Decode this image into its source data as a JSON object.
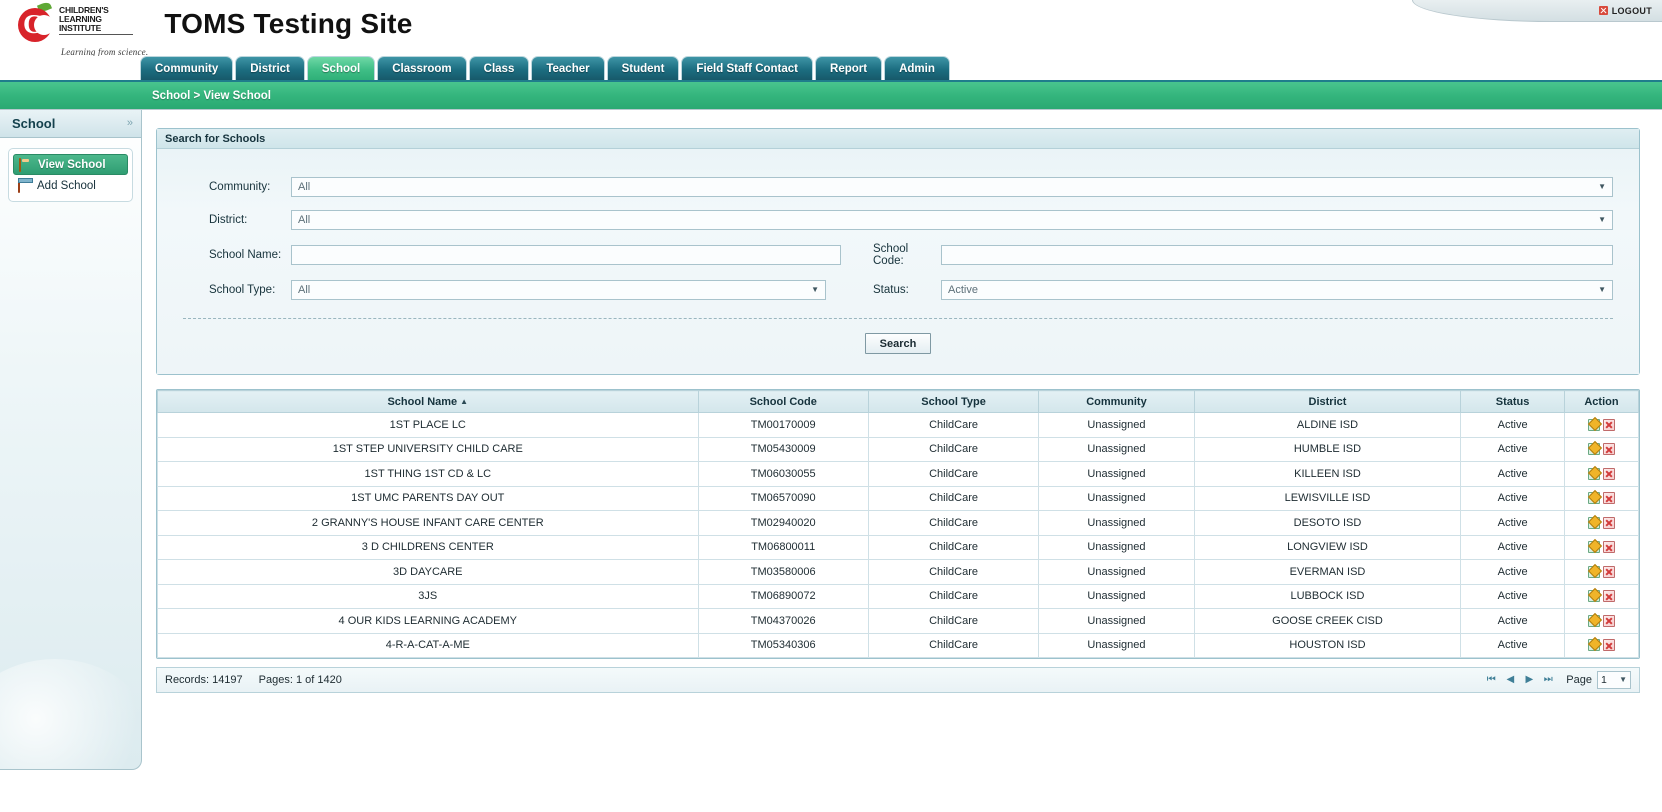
{
  "header": {
    "site_title": "TOMS Testing Site",
    "logo_lines": [
      "CHILDREN'S",
      "LEARNING",
      "INSTITUTE"
    ],
    "logo_letter": "C",
    "tagline": "Learning from science.",
    "logout_label": "LOGOUT"
  },
  "tabs": [
    {
      "label": "Community",
      "active": false
    },
    {
      "label": "District",
      "active": false
    },
    {
      "label": "School",
      "active": true
    },
    {
      "label": "Classroom",
      "active": false
    },
    {
      "label": "Class",
      "active": false
    },
    {
      "label": "Teacher",
      "active": false
    },
    {
      "label": "Student",
      "active": false
    },
    {
      "label": "Field Staff Contact",
      "active": false
    },
    {
      "label": "Report",
      "active": false
    },
    {
      "label": "Admin",
      "active": false
    }
  ],
  "breadcrumb": "School > View School",
  "sidebar": {
    "title": "School",
    "collapse_glyph": "»",
    "items": [
      {
        "label": "View School",
        "icon": "view-school-icon",
        "active": true
      },
      {
        "label": "Add School",
        "icon": "add-school-icon",
        "active": false
      }
    ]
  },
  "search_panel": {
    "title": "Search for Schools",
    "fields": {
      "community_label": "Community:",
      "community_value": "All",
      "district_label": "District:",
      "district_value": "All",
      "school_name_label": "School Name:",
      "school_name_value": "",
      "school_code_label": "School Code:",
      "school_code_value": "",
      "school_type_label": "School Type:",
      "school_type_value": "All",
      "status_label": "Status:",
      "status_value": "Active"
    },
    "caret_glyph": "▼",
    "search_button": "Search"
  },
  "table": {
    "columns": [
      "School Name",
      "School Code",
      "School Type",
      "Community",
      "District",
      "Status",
      "Action"
    ],
    "sort_column": "School Name",
    "sort_glyph": "▲",
    "rows": [
      {
        "name": "1ST PLACE LC",
        "code": "TM00170009",
        "type": "ChildCare",
        "community": "Unassigned",
        "district": "ALDINE ISD",
        "status": "Active"
      },
      {
        "name": "1ST STEP UNIVERSITY CHILD CARE",
        "code": "TM05430009",
        "type": "ChildCare",
        "community": "Unassigned",
        "district": "HUMBLE ISD",
        "status": "Active"
      },
      {
        "name": "1ST THING 1ST CD & LC",
        "code": "TM06030055",
        "type": "ChildCare",
        "community": "Unassigned",
        "district": "KILLEEN ISD",
        "status": "Active"
      },
      {
        "name": "1ST UMC PARENTS DAY OUT",
        "code": "TM06570090",
        "type": "ChildCare",
        "community": "Unassigned",
        "district": "LEWISVILLE ISD",
        "status": "Active"
      },
      {
        "name": "2 GRANNY'S HOUSE INFANT CARE CENTER",
        "code": "TM02940020",
        "type": "ChildCare",
        "community": "Unassigned",
        "district": "DESOTO ISD",
        "status": "Active"
      },
      {
        "name": "3 D CHILDRENS CENTER",
        "code": "TM06800011",
        "type": "ChildCare",
        "community": "Unassigned",
        "district": "LONGVIEW ISD",
        "status": "Active"
      },
      {
        "name": "3D DAYCARE",
        "code": "TM03580006",
        "type": "ChildCare",
        "community": "Unassigned",
        "district": "EVERMAN ISD",
        "status": "Active"
      },
      {
        "name": "3JS",
        "code": "TM06890072",
        "type": "ChildCare",
        "community": "Unassigned",
        "district": "LUBBOCK ISD",
        "status": "Active"
      },
      {
        "name": "4 OUR KIDS LEARNING ACADEMY",
        "code": "TM04370026",
        "type": "ChildCare",
        "community": "Unassigned",
        "district": "GOOSE CREEK CISD",
        "status": "Active"
      },
      {
        "name": "4-R-A-CAT-A-ME",
        "code": "TM05340306",
        "type": "ChildCare",
        "community": "Unassigned",
        "district": "HOUSTON ISD",
        "status": "Active"
      }
    ]
  },
  "footer": {
    "records": "Records: 14197",
    "pages": "Pages: 1 of 1420",
    "first_glyph": "⏮",
    "prev_glyph": "◀",
    "next_glyph": "▶",
    "last_glyph": "⏭",
    "page_label": "Page",
    "page_value": "1",
    "page_caret": "▼"
  },
  "colors": {
    "accent_green": "#2fb078",
    "tab_blue": "#1c6d80",
    "panel_border": "#9cc2cd"
  }
}
